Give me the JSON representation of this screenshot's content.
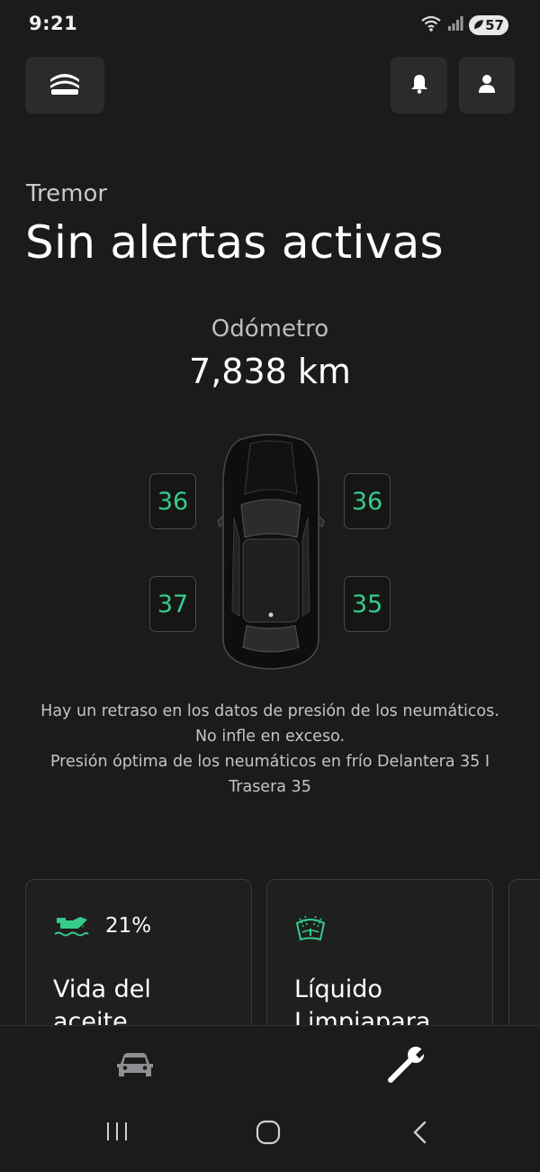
{
  "status_bar": {
    "time": "9:21",
    "battery": "57"
  },
  "header": {
    "vehicle_name": "Tremor",
    "alert_title": "Sin alertas activas"
  },
  "odometer": {
    "label": "Odómetro",
    "value": "7,838 km"
  },
  "tires": {
    "front_left": "36",
    "front_right": "36",
    "rear_left": "37",
    "rear_right": "35"
  },
  "info": {
    "line1": "Hay un retraso en los datos de presión de los neumáticos. No infle en exceso.",
    "line2": "Presión óptima de los neumáticos en frío Delantera 35 I Trasera 35"
  },
  "cards": [
    {
      "percent": "21%",
      "title": "Vida del aceite",
      "icon": "oil-can-icon"
    },
    {
      "title": "Líquido Limpiapara",
      "icon": "windshield-washer-icon"
    }
  ],
  "colors": {
    "accent": "#35cc8a",
    "background": "#1b1b1c",
    "surface": "#2b2b2c"
  }
}
